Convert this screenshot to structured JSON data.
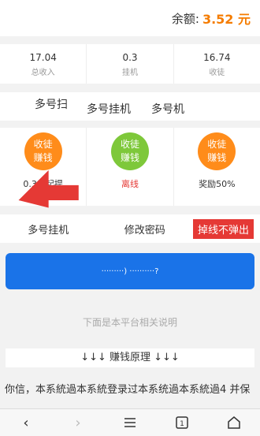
{
  "balance": {
    "label": "余额:",
    "amount": "3.52 元"
  },
  "stats": [
    {
      "value": "17.04",
      "label": "总收入"
    },
    {
      "value": "0.3",
      "label": "挂机"
    },
    {
      "value": "16.74",
      "label": "收徒"
    }
  ],
  "tabs": [
    "多号扫",
    "多号挂机",
    "多号机"
  ],
  "cards": [
    {
      "line1": "收徒",
      "line2": "赚钱",
      "caption": "0.3元起提"
    },
    {
      "line1": "收徒",
      "line2": "赚钱",
      "caption": "离线"
    },
    {
      "line1": "收徒",
      "line2": "赚钱",
      "caption": "奖励50%"
    }
  ],
  "actions": {
    "multi_hang": "多号挂机",
    "change_password": "修改密码",
    "offline_no_popup": "掉线不弹出"
  },
  "big_button": {
    "label": "·········) ··········?"
  },
  "note": "下面是本平台相关说明",
  "principle": "↓↓↓ 赚钱原理 ↓↓↓",
  "paragraph": "你信，本系統過本系統登录过本系统過本系統過4 并保",
  "colors": {
    "accent": "#f57c00",
    "primary": "#1a73e8",
    "danger": "#e53935",
    "green": "#7ec83a",
    "orange": "#ff8c1a"
  },
  "nav": {
    "back": "back-icon",
    "forward": "forward-icon",
    "menu": "menu-icon",
    "tabs": "tabs-icon",
    "home": "home-icon"
  }
}
